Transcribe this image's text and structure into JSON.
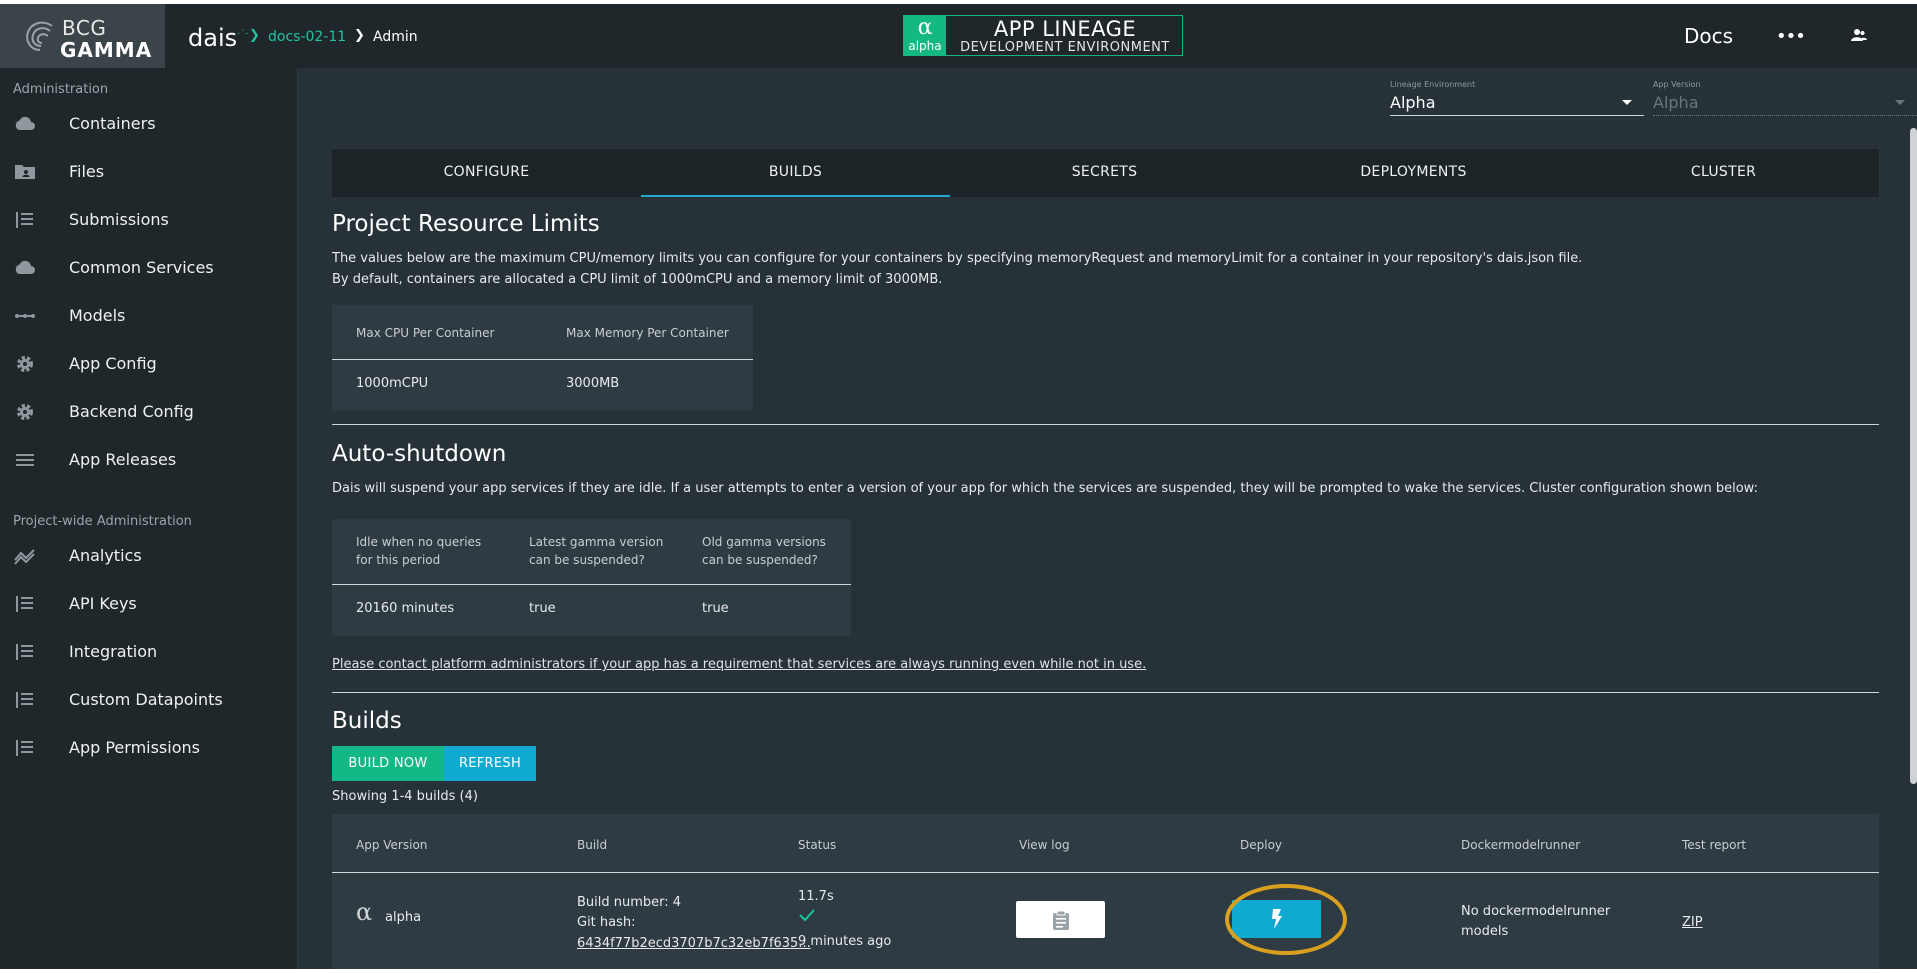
{
  "header": {
    "logo_line1": "BCG",
    "logo_line2": "GAMMA",
    "app_name": "dais",
    "breadcrumb": [
      "docs-02-11",
      "Admin"
    ],
    "env_badge": {
      "glyph": "α",
      "tag": "alpha",
      "title": "APP LINEAGE",
      "subtitle": "DEVELOPMENT ENVIRONMENT"
    },
    "docs_label": "Docs",
    "more_label": "•••"
  },
  "sidebar": {
    "section_admin": "Administration",
    "admin_items": [
      {
        "label": "Containers",
        "icon": "cloud-icon"
      },
      {
        "label": "Files",
        "icon": "folder-icon"
      },
      {
        "label": "Submissions",
        "icon": "list-icon"
      },
      {
        "label": "Common Services",
        "icon": "cloud-icon"
      },
      {
        "label": "Models",
        "icon": "model-icon"
      },
      {
        "label": "App Config",
        "icon": "gear-icon"
      },
      {
        "label": "Backend Config",
        "icon": "gear-icon"
      },
      {
        "label": "App Releases",
        "icon": "menu-icon"
      }
    ],
    "section_project": "Project-wide Administration",
    "project_items": [
      {
        "label": "Analytics",
        "icon": "analytics-icon"
      },
      {
        "label": "API Keys",
        "icon": "list-icon"
      },
      {
        "label": "Integration",
        "icon": "list-icon"
      },
      {
        "label": "Custom Datapoints",
        "icon": "list-icon"
      },
      {
        "label": "App Permissions",
        "icon": "list-icon"
      }
    ]
  },
  "selectors": {
    "lineage": {
      "caption": "Lineage Environment",
      "value": "Alpha"
    },
    "version": {
      "caption": "App Version",
      "value": "Alpha"
    }
  },
  "tabs": [
    "CONFIGURE",
    "BUILDS",
    "SECRETS",
    "DEPLOYMENTS",
    "CLUSTER"
  ],
  "active_tab": "BUILDS",
  "limits": {
    "title": "Project Resource Limits",
    "line1": "The values below are the maximum CPU/memory limits you can configure for your containers by specifying memoryRequest and memoryLimit for a container in your repository's dais.json file.",
    "line2": "By default, containers are allocated a CPU limit of 1000mCPU and a memory limit of 3000MB.",
    "headers": [
      "Max CPU Per Container",
      "Max Memory Per Container"
    ],
    "values": [
      "1000mCPU",
      "3000MB"
    ]
  },
  "shutdown": {
    "title": "Auto-shutdown",
    "text": "Dais will suspend your app services if they are idle. If a user attempts to enter a version of your app for which the services are suspended, they will be prompted to wake the services. Cluster configuration shown below:",
    "headers": [
      [
        "Idle when no queries",
        "for this period"
      ],
      [
        "Latest gamma version",
        "can be suspended?"
      ],
      [
        "Old gamma versions",
        "can be suspended?"
      ]
    ],
    "values": [
      "20160 minutes",
      "true",
      "true"
    ],
    "contact": "Please contact platform administrators if your app has a requirement that services are always running even while not in use."
  },
  "builds": {
    "title": "Builds",
    "build_now": "BUILD NOW",
    "refresh": "REFRESH",
    "showing": "Showing 1-4 builds (4)",
    "headers": [
      "App Version",
      "Build",
      "Status",
      "View log",
      "Deploy",
      "Dockermodelrunner",
      "Test report"
    ],
    "rows": [
      {
        "version_glyph": "α",
        "version": "alpha",
        "build_number": "Build number: 4",
        "git_hash_label": "Git hash:",
        "git_hash": "6434f77b2ecd3707b7c32eb7f635...",
        "duration": "11.7s",
        "status_icon": "check-icon",
        "time_ago": "9 minutes ago",
        "dockermodelrunner": [
          "No dockermodelrunner",
          "models"
        ],
        "test_report": "ZIP"
      }
    ]
  },
  "colors": {
    "background": "#263238",
    "sidebar": "#1f272b",
    "accent_green": "#12b886",
    "accent_blue": "#10a9d1",
    "highlight_ring": "#d9a020"
  }
}
